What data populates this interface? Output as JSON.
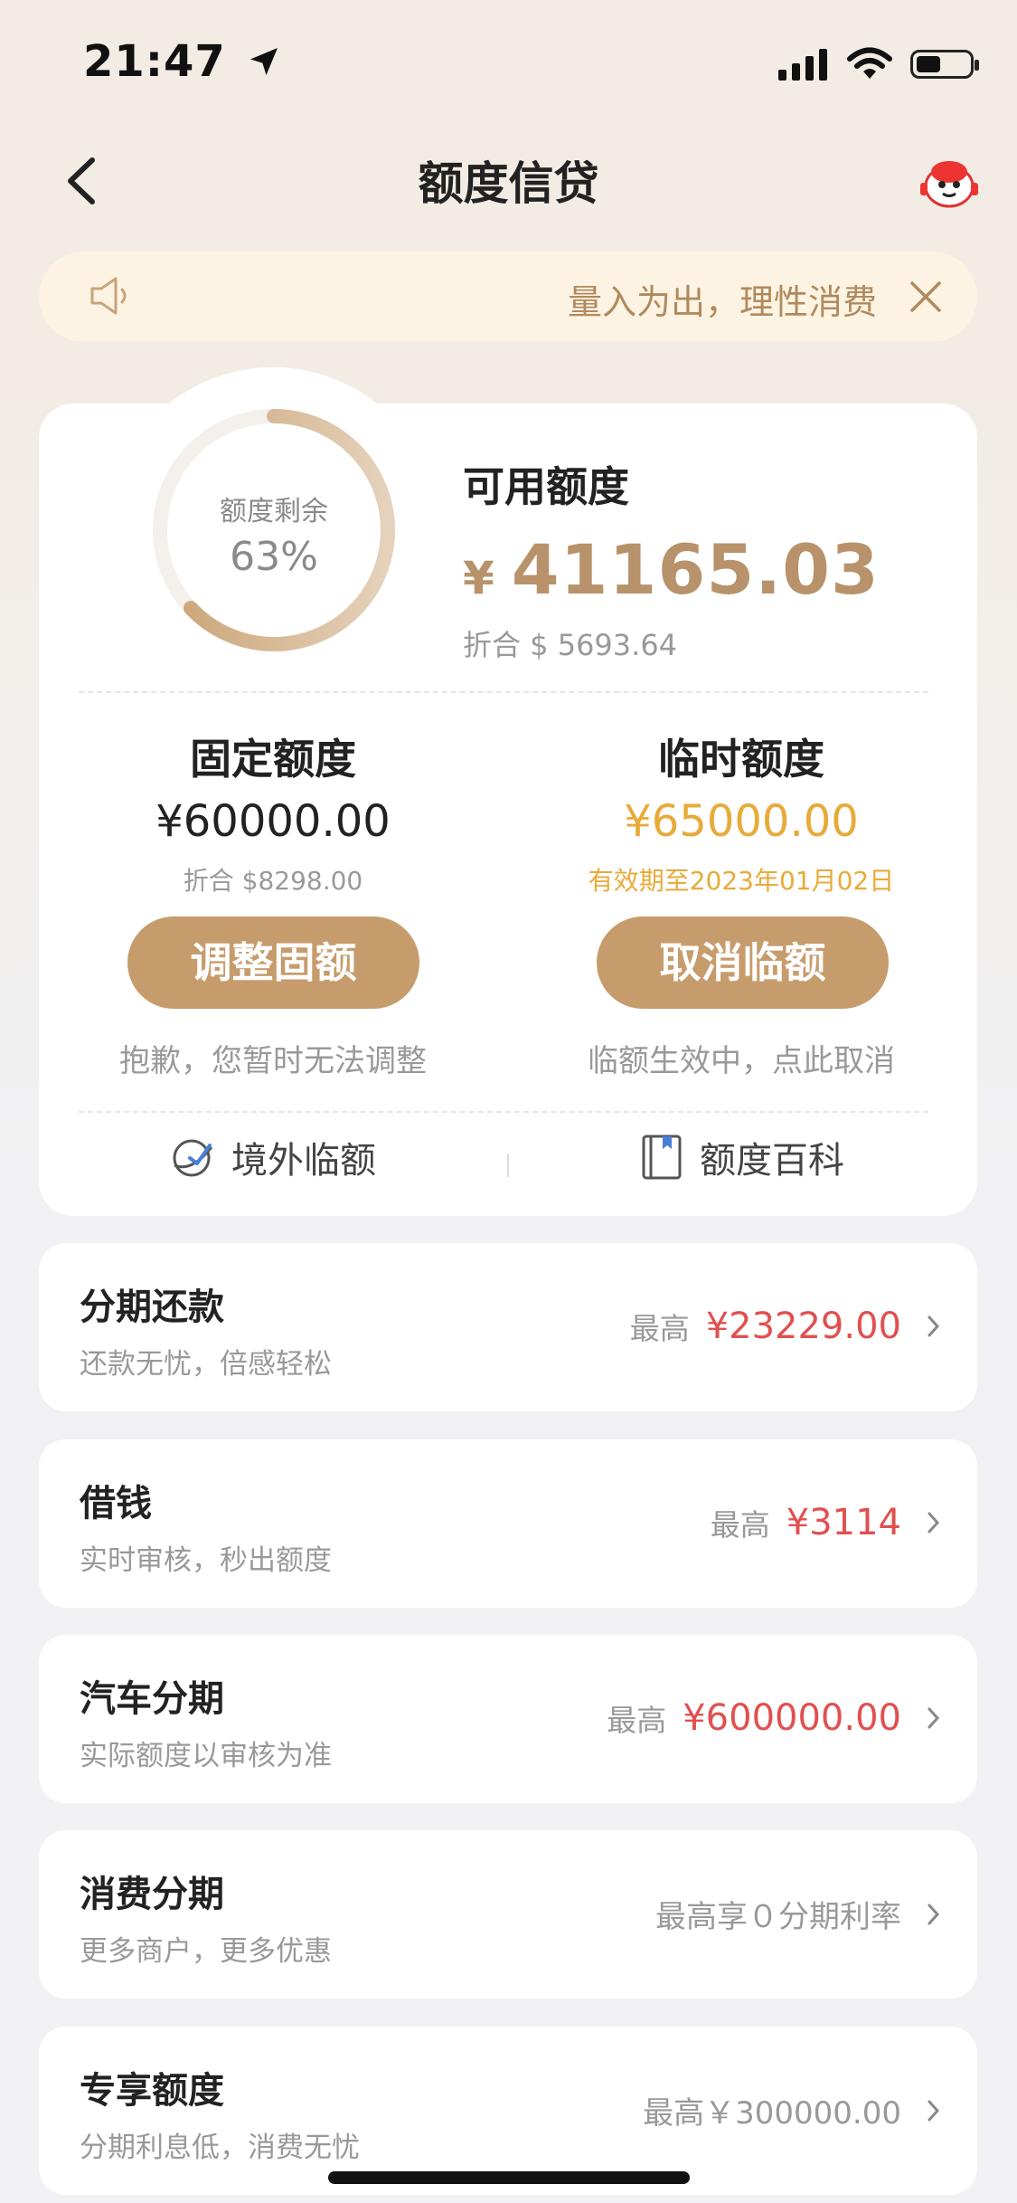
{
  "status_bar": {
    "time": "21:47",
    "battery_level": 0.45
  },
  "nav": {
    "title": "额度信贷"
  },
  "notice": {
    "text": "量入为出，理性消费"
  },
  "summary": {
    "ring_label": "额度剩余",
    "ring_percent": "63%",
    "ring_value": 0.63,
    "available_label": "可用额度",
    "available_currency": "¥",
    "available_amount": "41165.03",
    "available_usd": "折合 $ 5693.64"
  },
  "fixed": {
    "title": "固定额度",
    "amount": "¥60000.00",
    "usd": "折合 $8298.00",
    "button": "调整固额",
    "hint": "抱歉，您暂时无法调整"
  },
  "temp": {
    "title": "临时额度",
    "amount": "¥65000.00",
    "validity": "有效期至2023年01月02日",
    "button": "取消临额",
    "hint": "临额生效中，点此取消"
  },
  "links": {
    "overseas": "境外临额",
    "wiki": "额度百科"
  },
  "services": [
    {
      "title": "分期还款",
      "subtitle": "还款无忧，倍感轻松",
      "prefix": "最高",
      "amount": "¥23229.00"
    },
    {
      "title": "借钱",
      "subtitle": "实时审核，秒出额度",
      "prefix": "最高",
      "amount": "¥3114"
    },
    {
      "title": "汽车分期",
      "subtitle": "实际额度以审核为准",
      "prefix": "最高",
      "amount": "¥600000.00"
    },
    {
      "title": "消费分期",
      "subtitle": "更多商户，更多优惠",
      "prefix": "",
      "amount": "最高享０分期利率"
    },
    {
      "title": "专享额度",
      "subtitle": "分期利息低，消费无忧",
      "prefix": "",
      "amount": "最高￥300000.00"
    }
  ],
  "colors": {
    "gold": "#c79c6c",
    "orange": "#e8aa38",
    "red": "#e05050"
  }
}
